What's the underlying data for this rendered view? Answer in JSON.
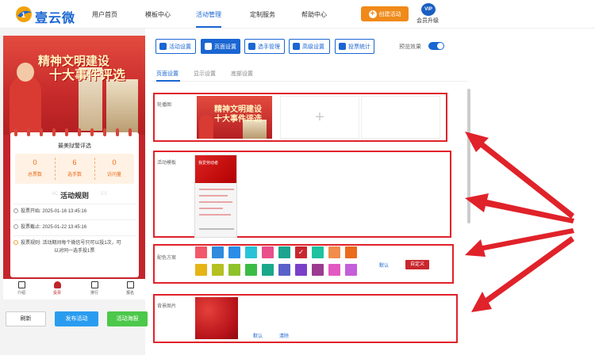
{
  "brand": {
    "name": "壹云微"
  },
  "nav": {
    "items": [
      "用户首页",
      "模板中心",
      "活动管理",
      "定制服务",
      "帮助中心"
    ],
    "active": "活动管理"
  },
  "header": {
    "create_label": "创建活动",
    "vip_badge": "VIP",
    "vip_label": "会员升级"
  },
  "preview": {
    "banner_line1": "精神文明建设",
    "banner_line2": "十大事件评选",
    "card_title": "最美狱警评选",
    "stats": [
      {
        "value": "0",
        "label": "总票数"
      },
      {
        "value": "6",
        "label": "选手数"
      },
      {
        "value": "0",
        "label": "访问量"
      }
    ],
    "rules_title": "活动规则",
    "rules_ghost_left": "AC",
    "rules_ghost_right": "ES",
    "start_label": "投票开始:",
    "start_value": "2025-01-16 13:45:16",
    "end_label": "投票截止:",
    "end_value": "2025-01-22 13:45:16",
    "rule_label": "投票规则:",
    "rule_text_1": "活动期间每个微信号只可以投1次，可",
    "rule_text_2": "以对同一选手投1票",
    "bottom_nav": [
      "介绍",
      "投票",
      "排行",
      "报名"
    ],
    "bottom_nav_active": "投票"
  },
  "actions": {
    "refresh": "刷新",
    "publish": "发布活动",
    "poster": "活动海报"
  },
  "toolbar": {
    "buttons": [
      "活动设置",
      "页面设置",
      "选手管理",
      "高级设置",
      "投票统计"
    ],
    "active": "页面设置",
    "preview_effect_label": "预览效果",
    "preview_effect_on": true
  },
  "subtabs": {
    "items": [
      "页面设置",
      "显示设置",
      "底部设置"
    ],
    "active": "页面设置"
  },
  "sections": {
    "carousel_label": "轮播图",
    "carousel_title_1": "精神文明建设",
    "carousel_title_2": "十大事件评选",
    "carousel_add": "+",
    "template_label": "活动模板",
    "template_header": "我爱劳动者",
    "color_label": "配色方案",
    "colors_row1": [
      "#f2596a",
      "#2e8bde",
      "#2a8ee6",
      "#29c3d7",
      "#e84f8b",
      "#1ca48f",
      "#c9272e",
      "#1dc29e",
      "#f08d4c",
      "#ec6a1c"
    ],
    "colors_row2": [
      "#e6b414",
      "#b5c021",
      "#8ec22a",
      "#3bbb46",
      "#19a88a",
      "#5a61c8",
      "#7a3fc9",
      "#9a3b8f",
      "#e359c2",
      "#c45ed9"
    ],
    "selected_color": "#c9272e",
    "check_mark": "✓",
    "color_default": "默认",
    "color_custom": "自定义",
    "bg_label": "背景图片",
    "bg_default": "默认",
    "bg_clear": "清除"
  },
  "annotation_color": "#e0222a",
  "accent": "#1a66d2"
}
